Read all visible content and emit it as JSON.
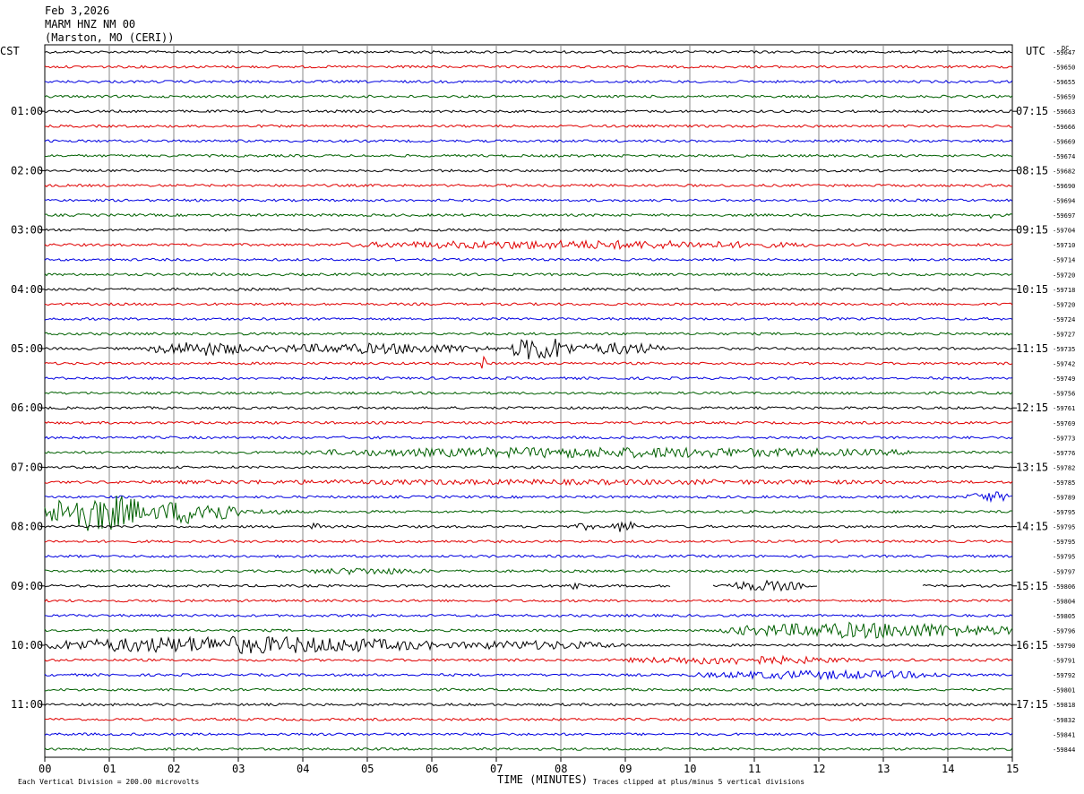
{
  "header": {
    "date": "Feb 3,2026",
    "station": "MARM HNZ NM 00",
    "location": "(Marston, MO (CERI))"
  },
  "chart_data": {
    "type": "line",
    "left_zone": "CST",
    "right_zone": "UTC",
    "dc_label": "DC",
    "xlabel": "TIME (MINUTES)",
    "xlim": [
      0,
      15
    ],
    "x_ticks": [
      "00",
      "01",
      "02",
      "03",
      "04",
      "05",
      "06",
      "07",
      "08",
      "09",
      "10",
      "11",
      "12",
      "13",
      "14",
      "15"
    ],
    "footer_left": "Each Vertical Division =  200.00 microvolts",
    "footer_right": "Traces clipped at plus/minus 5 vertical divisions",
    "trace_colors": [
      "#000000",
      "#e00000",
      "#0000e0",
      "#006000"
    ],
    "hour_labels_left": [
      {
        "row": 4,
        "label": "01:00"
      },
      {
        "row": 8,
        "label": "02:00"
      },
      {
        "row": 12,
        "label": "03:00"
      },
      {
        "row": 16,
        "label": "04:00"
      },
      {
        "row": 20,
        "label": "05:00"
      },
      {
        "row": 24,
        "label": "06:00"
      },
      {
        "row": 28,
        "label": "07:00"
      },
      {
        "row": 32,
        "label": "08:00"
      },
      {
        "row": 36,
        "label": "09:00"
      },
      {
        "row": 40,
        "label": "10:00"
      },
      {
        "row": 44,
        "label": "11:00"
      }
    ],
    "hour_labels_right": [
      {
        "row": 4,
        "label": "07:15"
      },
      {
        "row": 8,
        "label": "08:15"
      },
      {
        "row": 12,
        "label": "09:15"
      },
      {
        "row": 16,
        "label": "10:15"
      },
      {
        "row": 20,
        "label": "11:15"
      },
      {
        "row": 24,
        "label": "12:15"
      },
      {
        "row": 28,
        "label": "13:15"
      },
      {
        "row": 32,
        "label": "14:15"
      },
      {
        "row": 36,
        "label": "15:15"
      },
      {
        "row": 40,
        "label": "16:15"
      },
      {
        "row": 44,
        "label": "17:15"
      }
    ],
    "dc_offsets": [
      "-59647",
      "-59650",
      "-59655",
      "-59659",
      "-59663",
      "-59666",
      "-59669",
      "-59674",
      "-59682",
      "-59690",
      "-59694",
      "-59697",
      "-59704",
      "-59710",
      "-59714",
      "-59720",
      "-59718",
      "-59720",
      "-59724",
      "-59727",
      "-59735",
      "-59742",
      "-59749",
      "-59756",
      "-59761",
      "-59769",
      "-59773",
      "-59776",
      "-59782",
      "-59785",
      "-59789",
      "-59795",
      "-59795",
      "-59795",
      "-59795",
      "-59797",
      "-59806",
      "-59804",
      "-59805",
      "-59796",
      "-59790",
      "-59791",
      "-59792",
      "-59801",
      "-59818",
      "-59832",
      "-59841",
      "-59844"
    ],
    "events": [
      {
        "row": 11,
        "x0": 6.6,
        "x1": 6.65,
        "amp": 3
      },
      {
        "row": 11,
        "x0": 14.6,
        "x1": 14.7,
        "amp": 7
      },
      {
        "row": 13,
        "x0": 4.5,
        "x1": 12.0,
        "amp": 5
      },
      {
        "row": 20,
        "x0": 1.6,
        "x1": 3.2,
        "amp": 8
      },
      {
        "row": 20,
        "x0": 3.2,
        "x1": 7.0,
        "amp": 6
      },
      {
        "row": 20,
        "x0": 7.2,
        "x1": 8.2,
        "amp": 14
      },
      {
        "row": 20,
        "x0": 8.2,
        "x1": 9.6,
        "amp": 7
      },
      {
        "row": 21,
        "x0": 6.75,
        "x1": 6.85,
        "amp": 8
      },
      {
        "row": 27,
        "x0": 4.0,
        "x1": 13.5,
        "amp": 6
      },
      {
        "row": 29,
        "x0": 0.5,
        "x1": 15.0,
        "amp": 3
      },
      {
        "row": 30,
        "x0": 14.3,
        "x1": 15.0,
        "amp": 6
      },
      {
        "row": 31,
        "x0": 0.0,
        "x1": 1.6,
        "amp": 22
      },
      {
        "row": 31,
        "x0": 1.6,
        "x1": 3.0,
        "amp": 14
      },
      {
        "row": 31,
        "x0": 3.0,
        "x1": 4.0,
        "amp": 3
      },
      {
        "row": 32,
        "x0": 4.1,
        "x1": 4.3,
        "amp": 5
      },
      {
        "row": 32,
        "x0": 8.2,
        "x1": 8.6,
        "amp": 4
      },
      {
        "row": 32,
        "x0": 8.8,
        "x1": 9.2,
        "amp": 7
      },
      {
        "row": 35,
        "x0": 4.0,
        "x1": 6.0,
        "amp": 4
      },
      {
        "row": 36,
        "x0": 8.1,
        "x1": 8.35,
        "amp": 8
      },
      {
        "row": 36,
        "x0": 10.5,
        "x1": 11.8,
        "amp": 6
      },
      {
        "row": 39,
        "x0": 10.5,
        "x1": 15.0,
        "amp": 9
      },
      {
        "row": 40,
        "x0": 0.0,
        "x1": 6.0,
        "amp": 10
      },
      {
        "row": 40,
        "x0": 6.0,
        "x1": 9.0,
        "amp": 5
      },
      {
        "row": 41,
        "x0": 9.0,
        "x1": 12.5,
        "amp": 5
      },
      {
        "row": 42,
        "x0": 10.0,
        "x1": 14.2,
        "amp": 5
      }
    ],
    "gaps": [
      {
        "row": 36,
        "x0": 9.7,
        "x1": 10.35
      },
      {
        "row": 36,
        "x0": 12.0,
        "x1": 13.6
      }
    ]
  }
}
